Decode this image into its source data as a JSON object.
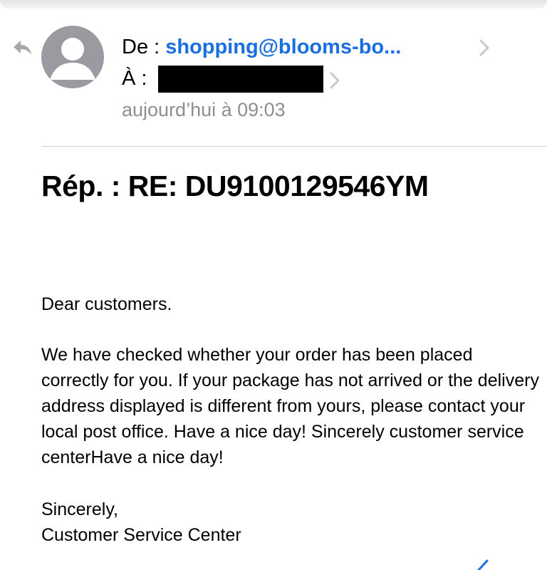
{
  "header": {
    "from_label": "De :",
    "from_sender": "shopping@blooms-bo...",
    "to_label": "À :",
    "date": "aujourd’hui à 09:03"
  },
  "email": {
    "subject": "Rép. : RE: DU9100129546YM",
    "greeting": "Dear customers.",
    "paragraph": "We have checked whether your order has been placed correctly for you. If your package has not arrived or the delivery address displayed is different from yours, please contact your local post office. Have a nice day! Sincerely customer service centerHave a nice day!",
    "signoff": "Sincerely,",
    "signature": "Customer Service Center"
  },
  "icons": {
    "reply_indicator": "reply-arrow-icon",
    "avatar": "person-icon",
    "chevron": "chevron-right-icon",
    "bottom_action": "compose-icon"
  },
  "colors": {
    "sender_link": "#1a6fe0",
    "secondary_text": "#8e8e93",
    "avatar_gray": "#9a9aa0",
    "chevron_gray": "#c7c7cc",
    "redaction": "#000000"
  }
}
